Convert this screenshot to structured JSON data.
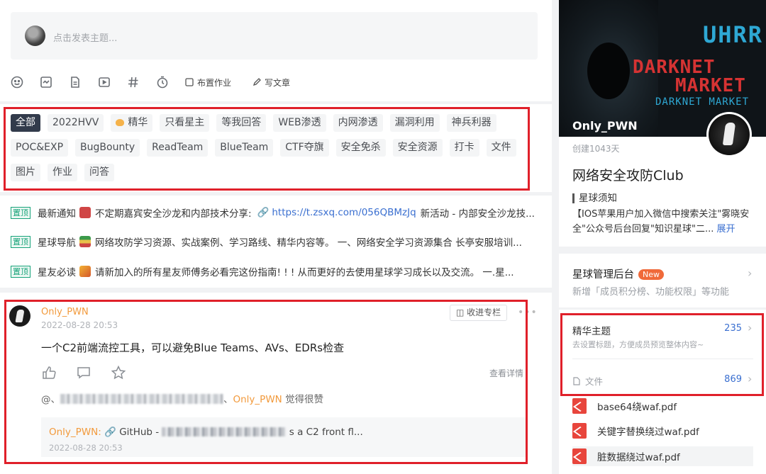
{
  "composer": {
    "placeholder": "点击发表主题...",
    "homework_label": "布置作业",
    "article_label": "写文章"
  },
  "tags": [
    "全部",
    "2022HVV",
    "精华",
    "只看星主",
    "等我回答",
    "WEB渗透",
    "内网渗透",
    "漏洞利用",
    "神兵利器",
    "POC&EXP",
    "BugBounty",
    "ReadTeam",
    "BlueTeam",
    "CTF夺旗",
    "安全免杀",
    "安全资源",
    "打卡",
    "文件",
    "图片",
    "作业",
    "问答"
  ],
  "pinned": [
    {
      "badge": "置顶",
      "title": "最新通知",
      "text": "不定期嘉宾安全沙龙和内部技术分享:",
      "link": "https://t.zsxq.com/056QBMzJq",
      "rest": "新活动 - 内部安全沙龙技..."
    },
    {
      "badge": "置顶",
      "title": "星球导航",
      "text": "网络攻防学习资源、实战案例、学习路线、精华内容等。 一、网络安全学习资源集合 长亭安服培训...",
      "link": "",
      "rest": ""
    },
    {
      "badge": "置顶",
      "title": "星友必读",
      "text": "请新加入的所有星友师傅务必看完这份指南! ! ! 从而更好的去使用星球学习成长以及交流。 一.星...",
      "link": "",
      "rest": ""
    }
  ],
  "post": {
    "author": "Only_PWN",
    "time": "2022-08-28 20:53",
    "collect_label": "收进专栏",
    "content": "一个C2前端流控工具，可以避免Blue Teams、AVs、EDRs检查",
    "view_detail": "查看详情",
    "likes_prefix": "@、",
    "likes_sep": "、",
    "likes_author": "Only_PWN",
    "likes_suffix": "觉得很赞",
    "comment": {
      "author": "Only_PWN:",
      "link_label": "GitHub -",
      "text_tail": "s a C2 front fl...",
      "time": "2022-08-28 20:53"
    }
  },
  "sidebar": {
    "cover_text_1": "UHRR",
    "cover_text_2": "DARKNET",
    "cover_text_3": "MARKET",
    "cover_text_4": "DARKNET MARKET",
    "owner": "Only_PWN",
    "created": "创建1043天",
    "group_name": "网络安全攻防Club",
    "notice_title": "星球须知",
    "notice_body": "【IOS苹果用户加入微信中搜索关注\"雾晓安全\"公众号后台回复\"知识星球\"二...",
    "notice_expand": "展开",
    "admin_title": "星球管理后台",
    "admin_badge": "New",
    "admin_sub": "新增「成员积分榜、功能权限」等功能",
    "essence_title": "精华主题",
    "essence_count": "235",
    "essence_sub": "去设置标题，方便成员预览整体内容~",
    "files_title": "文件",
    "files_count": "869",
    "files": [
      "base64绕waf.pdf",
      "关键字替换绕过waf.pdf",
      "脏数据绕过waf.pdf"
    ]
  },
  "colors": {
    "accent_orange": "#f29a3c",
    "link_blue": "#3a6fd0",
    "pin_green": "#17a37a",
    "highlight_red": "#e0202a",
    "tag_active": "#323b4b"
  }
}
